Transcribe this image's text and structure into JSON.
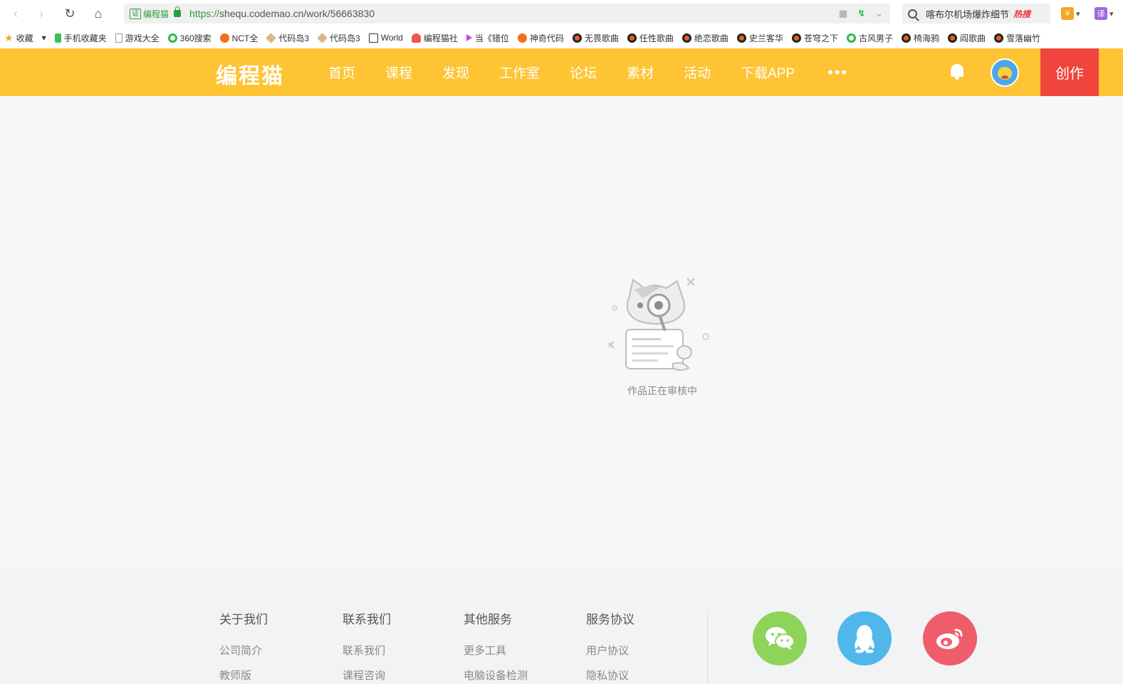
{
  "browser": {
    "cert_badge": "证",
    "cert_name": "编程猫",
    "url_proto": "https://",
    "url_rest": "shequ.codemao.cn/work/56663830",
    "search_query": "喀布尔机场爆炸细节",
    "search_hot": "热搜",
    "ext_yen": "¥",
    "ext_translate": "译"
  },
  "bookmarks": [
    {
      "label": "收藏",
      "icon": "star"
    },
    {
      "label": "手机收藏夹",
      "icon": "phone"
    },
    {
      "label": "游戏大全",
      "icon": "page"
    },
    {
      "label": "360搜索",
      "icon": "ring"
    },
    {
      "label": "NCT全",
      "icon": "red"
    },
    {
      "label": "代码岛3",
      "icon": "cube"
    },
    {
      "label": "代码岛3",
      "icon": "cube"
    },
    {
      "label": "World",
      "icon": "book"
    },
    {
      "label": "编程猫社",
      "icon": "cat"
    },
    {
      "label": "当《错位",
      "icon": "play"
    },
    {
      "label": "神奇代码",
      "icon": "red"
    },
    {
      "label": "无畏歌曲",
      "icon": "disc"
    },
    {
      "label": "任性歌曲",
      "icon": "disc"
    },
    {
      "label": "绝恋歌曲",
      "icon": "disc"
    },
    {
      "label": "史兰客华",
      "icon": "disc"
    },
    {
      "label": "苍穹之下",
      "icon": "disc"
    },
    {
      "label": "古风男子",
      "icon": "ring"
    },
    {
      "label": "椅海鸦",
      "icon": "disc"
    },
    {
      "label": "阎歌曲",
      "icon": "disc"
    },
    {
      "label": "雪落幽竹",
      "icon": "disc"
    }
  ],
  "site": {
    "logo": "编程猫",
    "nav": [
      "首页",
      "课程",
      "发现",
      "工作室",
      "论坛",
      "素材",
      "活动",
      "下载APP"
    ],
    "more": "•••",
    "create": "创作"
  },
  "main": {
    "empty_message": "作品正在审核中"
  },
  "footer": {
    "columns": [
      {
        "title": "关于我们",
        "links": [
          "公司简介",
          "教师版"
        ]
      },
      {
        "title": "联系我们",
        "links": [
          "联系我们",
          "课程咨询"
        ]
      },
      {
        "title": "其他服务",
        "links": [
          "更多工具",
          "电脑设备检测"
        ]
      },
      {
        "title": "服务协议",
        "links": [
          "用户协议",
          "隐私协议"
        ]
      }
    ]
  },
  "colors": {
    "header": "#fec433",
    "create": "#f0453d",
    "wechat": "#8ed35a",
    "qq": "#4fb7ea",
    "weibo": "#ef5d6b"
  }
}
